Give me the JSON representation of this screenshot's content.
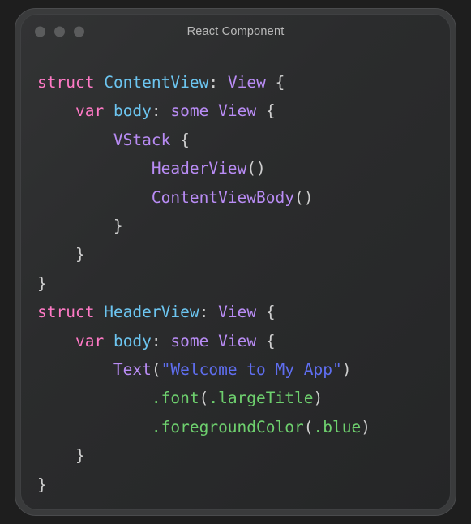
{
  "window": {
    "title": "React Component",
    "traffic_lights": [
      {
        "name": "close-button",
        "color": "#5b5c5d"
      },
      {
        "name": "minimize-button",
        "color": "#5b5c5d"
      },
      {
        "name": "maximize-button",
        "color": "#5b5c5d"
      }
    ]
  },
  "theme": {
    "frame_bg": "#3a3b3c",
    "panel_bg": "#2b2c2d",
    "title_color": "#b9b9b9",
    "keyword": "#ff7ac6",
    "identifier": "#6cc5f0",
    "type": "#b98cf5",
    "punctuation": "#cfcfcf",
    "string": "#5f6ef0",
    "method": "#6ed06e",
    "plain": "#d4d4d4"
  },
  "code": {
    "language": "swift",
    "plain_text": "struct ContentView: View {\n    var body: some View {\n        VStack {\n            HeaderView()\n            ContentViewBody()\n        }\n    }\n}\nstruct HeaderView: View {\n    var body: some View {\n        Text(\"Welcome to My App\")\n            .font(.largeTitle)\n            .foregroundColor(.blue)\n    }\n}",
    "lines": [
      {
        "indent": 0,
        "tokens": [
          {
            "t": "struct",
            "c": "keyword"
          },
          {
            "t": " ",
            "c": "plain"
          },
          {
            "t": "ContentView",
            "c": "ident"
          },
          {
            "t": ":",
            "c": "punct"
          },
          {
            "t": " ",
            "c": "plain"
          },
          {
            "t": "View",
            "c": "type"
          },
          {
            "t": " ",
            "c": "plain"
          },
          {
            "t": "{",
            "c": "punct"
          }
        ]
      },
      {
        "indent": 4,
        "tokens": [
          {
            "t": "var",
            "c": "keyword"
          },
          {
            "t": " ",
            "c": "plain"
          },
          {
            "t": "body",
            "c": "ident"
          },
          {
            "t": ":",
            "c": "punct"
          },
          {
            "t": " ",
            "c": "plain"
          },
          {
            "t": "some",
            "c": "type"
          },
          {
            "t": " ",
            "c": "plain"
          },
          {
            "t": "View",
            "c": "type"
          },
          {
            "t": " ",
            "c": "plain"
          },
          {
            "t": "{",
            "c": "punct"
          }
        ]
      },
      {
        "indent": 8,
        "tokens": [
          {
            "t": "VStack",
            "c": "type"
          },
          {
            "t": " ",
            "c": "plain"
          },
          {
            "t": "{",
            "c": "punct"
          }
        ]
      },
      {
        "indent": 12,
        "tokens": [
          {
            "t": "HeaderView",
            "c": "type"
          },
          {
            "t": "()",
            "c": "punct"
          }
        ]
      },
      {
        "indent": 12,
        "tokens": [
          {
            "t": "ContentViewBody",
            "c": "type"
          },
          {
            "t": "()",
            "c": "punct"
          }
        ]
      },
      {
        "indent": 8,
        "tokens": [
          {
            "t": "}",
            "c": "punct"
          }
        ]
      },
      {
        "indent": 4,
        "tokens": [
          {
            "t": "}",
            "c": "punct"
          }
        ]
      },
      {
        "indent": 0,
        "tokens": [
          {
            "t": "}",
            "c": "punct"
          }
        ]
      },
      {
        "indent": 0,
        "tokens": [
          {
            "t": "struct",
            "c": "keyword"
          },
          {
            "t": " ",
            "c": "plain"
          },
          {
            "t": "HeaderView",
            "c": "ident"
          },
          {
            "t": ":",
            "c": "punct"
          },
          {
            "t": " ",
            "c": "plain"
          },
          {
            "t": "View",
            "c": "type"
          },
          {
            "t": " ",
            "c": "plain"
          },
          {
            "t": "{",
            "c": "punct"
          }
        ]
      },
      {
        "indent": 4,
        "tokens": [
          {
            "t": "var",
            "c": "keyword"
          },
          {
            "t": " ",
            "c": "plain"
          },
          {
            "t": "body",
            "c": "ident"
          },
          {
            "t": ":",
            "c": "punct"
          },
          {
            "t": " ",
            "c": "plain"
          },
          {
            "t": "some",
            "c": "type"
          },
          {
            "t": " ",
            "c": "plain"
          },
          {
            "t": "View",
            "c": "type"
          },
          {
            "t": " ",
            "c": "plain"
          },
          {
            "t": "{",
            "c": "punct"
          }
        ]
      },
      {
        "indent": 8,
        "tokens": [
          {
            "t": "Text",
            "c": "type"
          },
          {
            "t": "(",
            "c": "punct"
          },
          {
            "t": "\"Welcome to My App\"",
            "c": "string"
          },
          {
            "t": ")",
            "c": "punct"
          }
        ]
      },
      {
        "indent": 12,
        "tokens": [
          {
            "t": ".font",
            "c": "method"
          },
          {
            "t": "(",
            "c": "punct"
          },
          {
            "t": ".largeTitle",
            "c": "method"
          },
          {
            "t": ")",
            "c": "punct"
          }
        ]
      },
      {
        "indent": 12,
        "tokens": [
          {
            "t": ".foregroundColor",
            "c": "method"
          },
          {
            "t": "(",
            "c": "punct"
          },
          {
            "t": ".blue",
            "c": "method"
          },
          {
            "t": ")",
            "c": "punct"
          }
        ]
      },
      {
        "indent": 4,
        "tokens": [
          {
            "t": "}",
            "c": "punct"
          }
        ]
      },
      {
        "indent": 0,
        "tokens": [
          {
            "t": "}",
            "c": "punct"
          }
        ]
      }
    ]
  }
}
